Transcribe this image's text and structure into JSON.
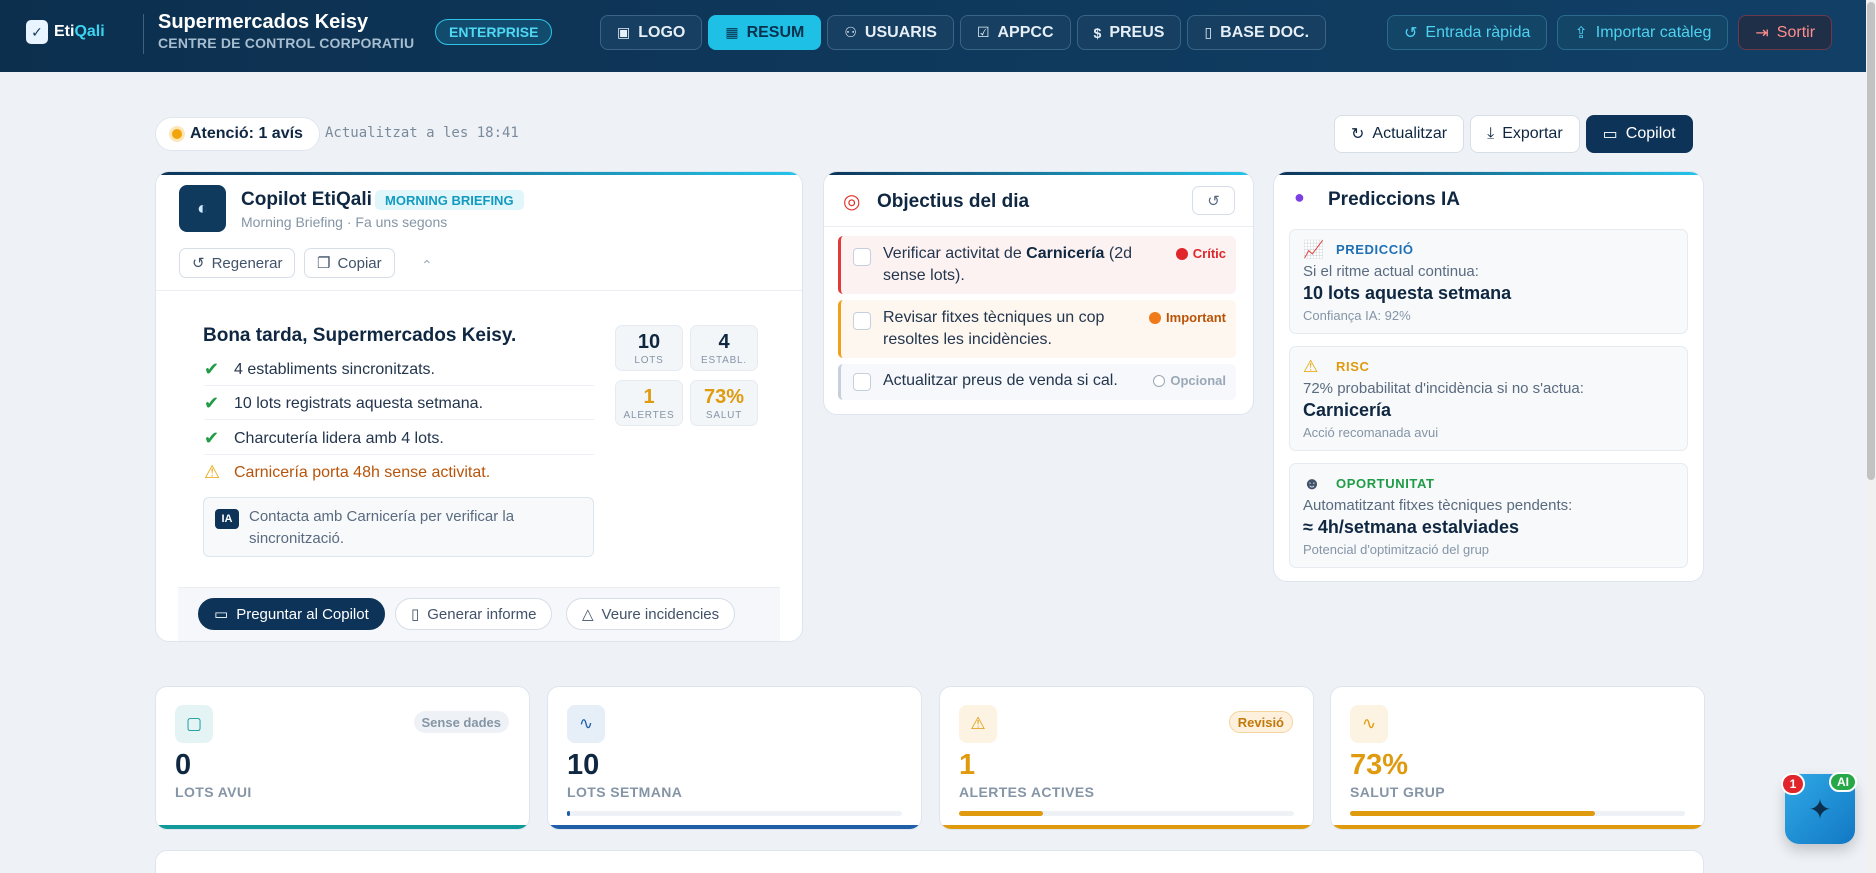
{
  "header": {
    "logo_text_a": "Eti",
    "logo_text_b": "Qali",
    "title": "Supermercados Keisy",
    "subtitle": "CENTRE DE CONTROL CORPORATIU",
    "badge": "ENTERPRISE",
    "nav": [
      {
        "label": "LOGO",
        "icon": "image-icon"
      },
      {
        "label": "RESUM",
        "icon": "grid-icon"
      },
      {
        "label": "USUARIS",
        "icon": "users-icon"
      },
      {
        "label": "APPCC",
        "icon": "checkbox-icon"
      },
      {
        "label": "PREUS",
        "icon": "dollar-icon"
      },
      {
        "label": "BASE DOC.",
        "icon": "document-icon"
      }
    ],
    "quick_entry": "Entrada ràpida",
    "import_catalog": "Importar catàleg",
    "exit": "Sortir"
  },
  "status": {
    "alert": "Atenció: 1 avís",
    "updated": "Actualitzat a les 18:41"
  },
  "actions": {
    "refresh": "Actualitzar",
    "export": "Exportar",
    "copilot": "Copilot"
  },
  "copilot": {
    "title": "Copilot EtiQali",
    "badge": "MORNING BRIEFING",
    "sub_type": "Morning Briefing",
    "sub_time": "Fa uns segons",
    "regenerate": "Regenerar",
    "copy": "Copiar",
    "greeting": "Bona tarda, Supermercados Keisy.",
    "bullets": [
      "4 establiments sincronitzats.",
      "10 lots registrats aquesta setmana.",
      "Charcutería lidera amb 4 lots.",
      "Carnicería porta 48h sense activitat."
    ],
    "ia_tag": "IA",
    "ia_text": "Contacta amb Carnicería per verificar la sincronització.",
    "stats": [
      {
        "value": "10",
        "label": "LOTS"
      },
      {
        "value": "4",
        "label": "ESTABL."
      },
      {
        "value": "1",
        "label": "ALERTES"
      },
      {
        "value": "73%",
        "label": "SALUT"
      }
    ],
    "ask": "Preguntar al Copilot",
    "report": "Generar informe",
    "incidents": "Veure incidencies"
  },
  "objectives": {
    "title": "Objectius del dia",
    "tasks": [
      {
        "pre": "Verificar activitat de ",
        "bold": "Carnicería",
        "post": " (2d sense lots).",
        "priority": "Crític",
        "color": "#e0262b"
      },
      {
        "pre": "Revisar fitxes tècniques un cop resoltes les incidències.",
        "bold": "",
        "post": "",
        "priority": "Important",
        "color": "#f07a1a"
      },
      {
        "pre": "Actualitzar preus de venda si cal.",
        "bold": "",
        "post": "",
        "priority": "Opcional",
        "color": "#9aa8b6"
      }
    ]
  },
  "predictions": {
    "title": "Prediccions IA",
    "items": [
      {
        "tag": "PREDICCIÓ",
        "line1": "Si el ritme actual continua:",
        "line2": "10 lots aquesta setmana",
        "line3": "Confiança IA: 92%",
        "color": "#1f6fb5",
        "icon": "chart-icon"
      },
      {
        "tag": "RISC",
        "line1": "72% probabilitat d'incidència si no s'actua:",
        "line2": "Carnicería",
        "line3": "Acció recomanada avui",
        "color": "#e09a0e",
        "icon": "warning-icon"
      },
      {
        "tag": "OPORTUNITAT",
        "line1": "Automatitzant fitxes tècniques pendents:",
        "line2": "≈ 4h/setmana estalviades",
        "line3": "Potencial d'optimització del grup",
        "color": "#1f9c45",
        "icon": "robot-icon"
      }
    ]
  },
  "kpis": [
    {
      "value": "0",
      "label": "LOTS AVUI",
      "badge": "Sense dades",
      "progress": 0,
      "color": "#0f2741",
      "accent": "#129a9a"
    },
    {
      "value": "10",
      "label": "LOTS SETMANA",
      "badge": "",
      "progress": 0.01,
      "color": "#0f2741",
      "accent": "#1f5fa8"
    },
    {
      "value": "1",
      "label": "ALERTES ACTIVES",
      "badge": "Revisió",
      "progress": 0.25,
      "color": "#e09a0e",
      "accent": "#e09a0e"
    },
    {
      "value": "73%",
      "label": "SALUT GRUP",
      "badge": "",
      "progress": 0.73,
      "color": "#e09a0e",
      "accent": "#e09a0e"
    }
  ],
  "fab": {
    "count": "1",
    "badge": "AI"
  }
}
